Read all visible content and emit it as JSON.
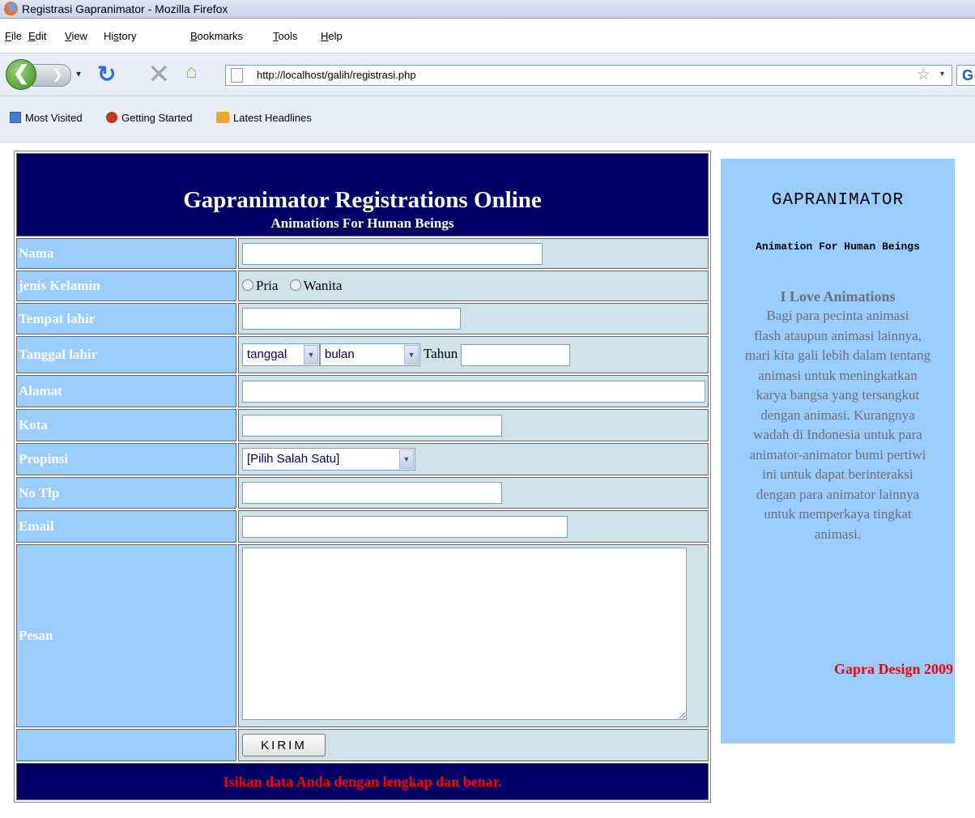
{
  "window": {
    "title": "Registrasi Gapranimator - Mozilla Firefox"
  },
  "menu": [
    {
      "key": "F",
      "rest": "ile"
    },
    {
      "key": "E",
      "rest": "dit"
    },
    {
      "key": "V",
      "rest": "iew"
    },
    {
      "pre": "Hi",
      "key": "s",
      "rest": "tory"
    },
    {
      "key": "B",
      "rest": "ookmarks"
    },
    {
      "key": "T",
      "rest": "ools"
    },
    {
      "key": "H",
      "rest": "elp"
    }
  ],
  "navigation": {
    "url": "http://localhost/galih/registrasi.php",
    "search_letter": "G"
  },
  "bookmarks": [
    "Most Visited",
    "Getting Started",
    "Latest Headlines"
  ],
  "form": {
    "title": "Gapranimator Registrations Online",
    "subtitle": "Animations For Human Beings",
    "labels": {
      "nama": "Nama",
      "jenis_kelamin": "jenis Kelamin",
      "tempat_lahir": "Tempat lahir",
      "tanggal_lahir": "Tanggal lahir",
      "alamat": "Alamat",
      "kota": "Kota",
      "propinsi": "Propinsi",
      "no_tlp": "No Tlp",
      "email": "Email",
      "pesan": "Pesan"
    },
    "values": {
      "nama": "",
      "tempat_lahir": "",
      "tahun": "",
      "alamat": "",
      "kota": "",
      "no_tlp": "",
      "email": "",
      "pesan": ""
    },
    "gender_options": [
      "Pria",
      "Wanita"
    ],
    "tanggal_select": "tanggal",
    "bulan_select": "bulan",
    "tahun_label": "Tahun",
    "propinsi_select": "[Pilih Salah Satu]",
    "submit_label": "KIRIM",
    "footer_note": "Isikan data Anda dengan lengkap dan benar."
  },
  "sidebar": {
    "brand": "GAPRANIMATOR",
    "tagline": "Animation For Human Beings",
    "heading": "I Love Animations",
    "lines": [
      "Bagi para pecinta animasi",
      "flash ataupun animasi lainnya,",
      "mari kita gali lebih dalam tentang",
      "animasi untuk meningkatkan",
      "karya bangsa yang tersangkut",
      "dengan animasi. Kurangnya",
      "wadah di Indonesia untuk para",
      "animator-animator bumi pertiwi",
      "ini untuk dapat berinteraksi",
      "dengan para animator lainnya",
      "untuk memperkaya tingkat",
      "animasi."
    ],
    "credit": "Gapra Design 2009"
  }
}
